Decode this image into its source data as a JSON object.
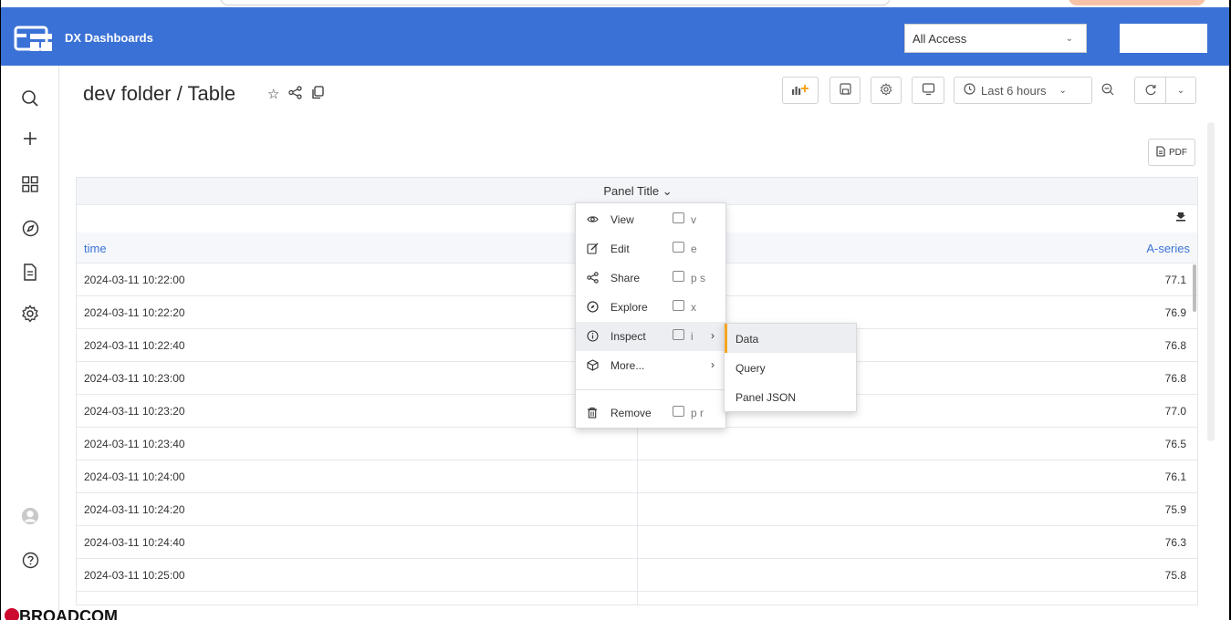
{
  "app": {
    "brand": "DX Dashboards"
  },
  "header": {
    "access_value": "All Access",
    "breadcrumb": "dev folder / Table",
    "time_range": "Last 6 hours",
    "pdf_label": "PDF"
  },
  "sidebar": {
    "items": [
      "search",
      "plus",
      "dashboards",
      "explore",
      "document",
      "settings",
      "profile",
      "help"
    ]
  },
  "panel": {
    "title": "Panel Title ⌄",
    "columns": [
      "time",
      "A-series"
    ],
    "rows": [
      {
        "time": "2024-03-11 10:22:00",
        "value": "77.1"
      },
      {
        "time": "2024-03-11 10:22:20",
        "value": "76.9"
      },
      {
        "time": "2024-03-11 10:22:40",
        "value": "76.8"
      },
      {
        "time": "2024-03-11 10:23:00",
        "value": "76.8"
      },
      {
        "time": "2024-03-11 10:23:20",
        "value": "77.0"
      },
      {
        "time": "2024-03-11 10:23:40",
        "value": "76.5"
      },
      {
        "time": "2024-03-11 10:24:00",
        "value": "76.1"
      },
      {
        "time": "2024-03-11 10:24:20",
        "value": "75.9"
      },
      {
        "time": "2024-03-11 10:24:40",
        "value": "76.3"
      },
      {
        "time": "2024-03-11 10:25:00",
        "value": "75.8"
      }
    ]
  },
  "menu": {
    "items": [
      {
        "label": "View",
        "key": "v"
      },
      {
        "label": "Edit",
        "key": "e"
      },
      {
        "label": "Share",
        "key": "p s"
      },
      {
        "label": "Explore",
        "key": "x"
      },
      {
        "label": "Inspect",
        "key": "i"
      },
      {
        "label": "More...",
        "key": ""
      },
      {
        "label": "Remove",
        "key": "p r"
      }
    ],
    "submenu": [
      "Data",
      "Query",
      "Panel JSON"
    ]
  },
  "footer": {
    "brand": "BROADCOM"
  },
  "colors": {
    "topbar": "#3a71d6",
    "link": "#3a74d8",
    "accent": "#f5a623"
  }
}
